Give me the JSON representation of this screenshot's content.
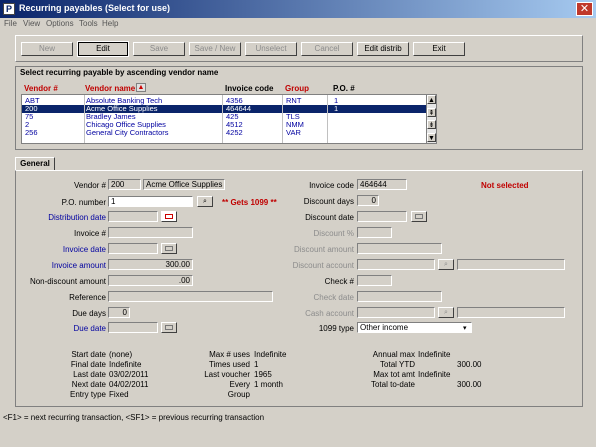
{
  "window": {
    "title": "Recurring payables (Select for use)",
    "app_icon_glyph": "P"
  },
  "menu": [
    "File",
    "View",
    "Options",
    "Tools",
    "Help"
  ],
  "toolbar": {
    "new": "New",
    "edit": "Edit",
    "save": "Save",
    "save_new": "Save / New",
    "unselect": "Unselect",
    "cancel": "Cancel",
    "edit_distrib": "Edit distrib",
    "exit": "Exit"
  },
  "list": {
    "caption": "Select recurring payable by ascending vendor name",
    "headers": {
      "vendor_num": "Vendor #",
      "vendor_name": "Vendor name",
      "invoice_code": "Invoice code",
      "group": "Group",
      "po": "P.O. #"
    },
    "rows": [
      {
        "vendor": "ABT",
        "name": "Absolute Banking Tech",
        "invoice": "4356",
        "group": "RNT",
        "po": "1"
      },
      {
        "vendor": "200",
        "name": "Acme Office Supplies",
        "invoice": "464644",
        "group": "",
        "po": "1"
      },
      {
        "vendor": "75",
        "name": "Bradley      James",
        "invoice": "425",
        "group": "TLS",
        "po": ""
      },
      {
        "vendor": "2",
        "name": "Chicago Office Supplies",
        "invoice": "4512",
        "group": "NMM",
        "po": ""
      },
      {
        "vendor": "256",
        "name": "General City Contractors",
        "invoice": "4252",
        "group": "VAR",
        "po": ""
      }
    ]
  },
  "tab": {
    "general": "General"
  },
  "form": {
    "vendor_label": "Vendor #",
    "vendor_value": "200",
    "vendor_name": "Acme Office Supplies",
    "po_label": "P.O. number",
    "po_value": "1",
    "gets1099": "** Gets 1099 **",
    "distribution_date_label": "Distribution date",
    "invoice_num_label": "Invoice #",
    "invoice_date_label": "Invoice date",
    "invoice_amount_label": "Invoice amount",
    "invoice_amount_value": "300.00",
    "nondiscount_label": "Non-discount amount",
    "nondiscount_value": ".00",
    "reference_label": "Reference",
    "due_days_label": "Due days",
    "due_days_value": "0",
    "due_date_label": "Due date",
    "invoice_code_label": "Invoice code",
    "invoice_code_value": "464644",
    "not_selected": "Not selected",
    "discount_days_label": "Discount days",
    "discount_days_value": "0",
    "discount_date_label": "Discount date",
    "discount_pct_label": "Discount %",
    "discount_amount_label": "Discount amount",
    "discount_account_label": "Discount account",
    "check_label": "Check #",
    "check_date_label": "Check date",
    "cash_account_label": "Cash account",
    "type1099_label": "1099 type",
    "type1099_value": "Other income"
  },
  "summary": {
    "start_date_label": "Start date",
    "start_date": "(none)",
    "final_date_label": "Final date",
    "final_date": "Indefinite",
    "last_date_label": "Last date",
    "last_date": "03/02/2011",
    "next_date_label": "Next date",
    "next_date": "04/02/2011",
    "entry_type_label": "Entry type",
    "entry_type": "Fixed",
    "max_uses_label": "Max # uses",
    "max_uses": "Indefinite",
    "times_used_label": "Times used",
    "times_used": "1",
    "last_voucher_label": "Last voucher",
    "last_voucher": "1965",
    "every_label": "Every",
    "every": "1 month",
    "group_label": "Group",
    "annual_max_label": "Annual max",
    "annual_max": "Indefinite",
    "total_ytd_label": "Total YTD",
    "total_ytd": "300.00",
    "max_tot_amt_label": "Max tot amt",
    "max_tot_amt": "Indefinite",
    "total_todate_label": "Total to-date",
    "total_todate": "300.00"
  },
  "status": "<F1> = next recurring transaction, <SF1> = previous recurring transaction",
  "colors": {
    "title_blue": "#0a246a",
    "label_blue": "#0000a0",
    "red": "#c00000",
    "bg": "#d4d0c8"
  }
}
